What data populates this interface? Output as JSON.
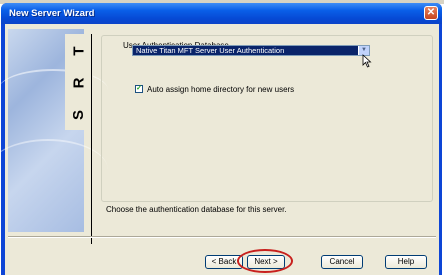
{
  "window": {
    "title": "New Server Wizard",
    "close_glyph": "✕",
    "titlebar_color": "#0a5fe8"
  },
  "sidepanel": {
    "logo_letters": [
      "T",
      "R",
      "S"
    ]
  },
  "auth": {
    "group_label": "User Authentication Database",
    "selected": "Native Titan MFT Server User Authentication",
    "arrow_glyph": "▼"
  },
  "options": {
    "auto_assign_label": "Auto assign home directory for new users",
    "auto_assign_checked": true,
    "check_glyph": "✓"
  },
  "hint": "Choose the authentication database for this server.",
  "buttons": {
    "back": "< Back",
    "next": "Next >",
    "cancel": "Cancel",
    "help": "Help"
  },
  "icons": {
    "close": "close-icon",
    "dropdown": "chevron-down-icon",
    "cursor": "mouse-cursor-icon",
    "check": "check-icon"
  }
}
